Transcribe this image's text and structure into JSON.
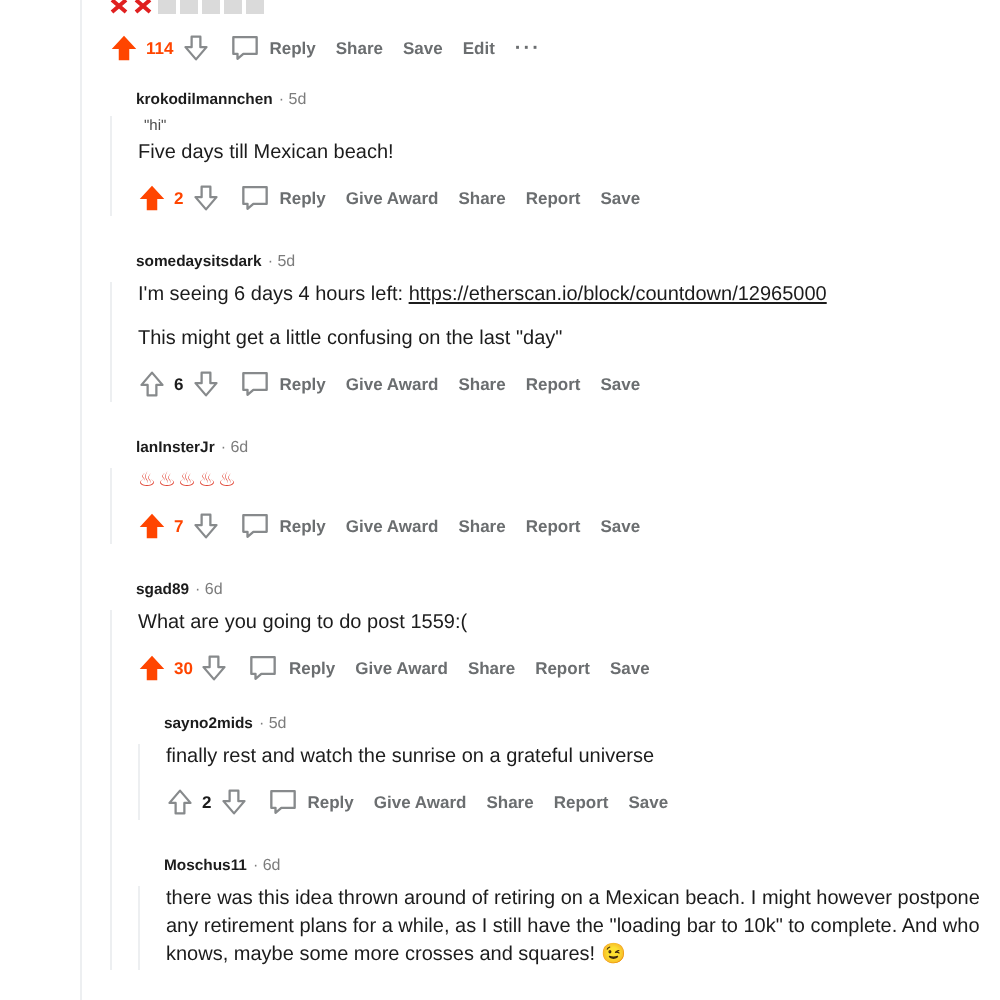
{
  "post_actions": {
    "score": "114",
    "upvoted": true,
    "buttons": [
      "Reply",
      "Share",
      "Save",
      "Edit"
    ],
    "more": "···"
  },
  "comments": [
    {
      "author": "krokodilmannchen",
      "age": "· 5d",
      "flair": "\"hi\"",
      "paragraphs": [
        [
          {
            "text": "Five days till Mexican beach!"
          }
        ]
      ],
      "score": "2",
      "upvoted": true,
      "buttons": [
        "Reply",
        "Give Award",
        "Share",
        "Report",
        "Save"
      ]
    },
    {
      "author": "somedaysitsdark",
      "age": "· 5d",
      "paragraphs": [
        [
          {
            "text": "I'm seeing 6 days 4 hours left: "
          },
          {
            "text": "https://etherscan.io/block/countdown/12965000",
            "kind": "link"
          }
        ],
        [
          {
            "text": "This might get a little confusing on the last \"day\""
          }
        ]
      ],
      "score": "6",
      "upvoted": false,
      "buttons": [
        "Reply",
        "Give Award",
        "Share",
        "Report",
        "Save"
      ]
    },
    {
      "author": "lanInsterJr",
      "age": "· 6d",
      "paragraphs": [
        [
          {
            "text": "♨♨♨♨♨",
            "kind": "emoji"
          }
        ]
      ],
      "score": "7",
      "upvoted": true,
      "buttons": [
        "Reply",
        "Give Award",
        "Share",
        "Report",
        "Save"
      ]
    },
    {
      "author": "sgad89",
      "age": "· 6d",
      "paragraphs": [
        [
          {
            "text": "What are you going to do post 1559:("
          }
        ]
      ],
      "score": "30",
      "upvoted": true,
      "buttons": [
        "Reply",
        "Give Award",
        "Share",
        "Report",
        "Save"
      ],
      "children": [
        {
          "author": "sayno2mids",
          "age": "· 5d",
          "paragraphs": [
            [
              {
                "text": "finally rest and watch the sunrise on a grateful universe"
              }
            ]
          ],
          "score": "2",
          "upvoted": false,
          "buttons": [
            "Reply",
            "Give Award",
            "Share",
            "Report",
            "Save"
          ]
        },
        {
          "author": "Moschus11",
          "age": "· 6d",
          "paragraphs": [
            [
              {
                "text": "there was this idea thrown around of retiring on a Mexican beach. I might however postpone any retirement plans for a while, as I still have the \"loading bar to 10k\" to complete. And who knows, maybe some more crosses and squares! 😉"
              }
            ]
          ]
        }
      ]
    }
  ]
}
